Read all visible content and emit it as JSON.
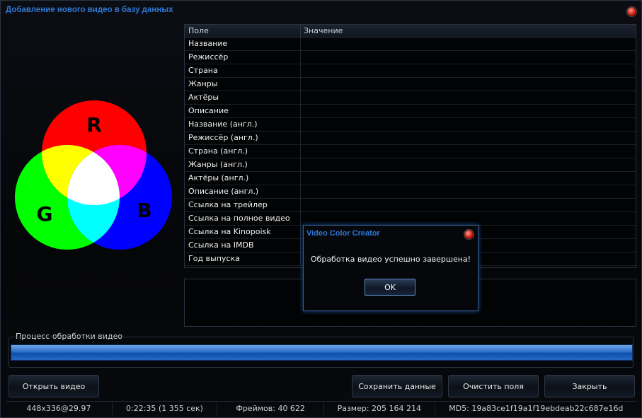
{
  "window": {
    "title": "Добавление нового видео в базу данных"
  },
  "rgb_logo": {
    "labels": [
      "R",
      "G",
      "B"
    ]
  },
  "grid": {
    "header": {
      "field": "Поле",
      "value": "Значение"
    },
    "rows": [
      "Название",
      "Режиссёр",
      "Страна",
      "Жанры",
      "Актёры",
      "Описание",
      "Название (англ.)",
      "Режиссёр (англ.)",
      "Страна (англ.)",
      "Жанры (англ.)",
      "Актёры (англ.)",
      "Описание (англ.)",
      "Ссылка на трейлер",
      "Ссылка на полное видео",
      "Ссылка на Kinopoisk",
      "Ссылка на IMDB",
      "Год выпуска"
    ]
  },
  "progress": {
    "label": "Процесс обработки видео",
    "value": 1.0
  },
  "buttons": {
    "open": "Открыть видео",
    "save": "Сохранить данные",
    "clear": "Очистить поля",
    "close": "Закрыть"
  },
  "status": {
    "resolution": "448x336@29.97",
    "duration": "0:22:35 (1 355 сек)",
    "frames": "Фреймов: 40 622",
    "size": "Размер: 205 164 214",
    "md5": "MD5: 19a83ce1f19a1f19ebdeab22c687e16d"
  },
  "dialog": {
    "title": "Video Color Creator",
    "message": "Обработка видео успешно завершена!",
    "ok": "OK"
  },
  "colors": {
    "accent": "#2f78d6",
    "progress": "#2b6fc7",
    "red": "#ff0000",
    "green": "#00ff00",
    "blue": "#0000ff"
  }
}
